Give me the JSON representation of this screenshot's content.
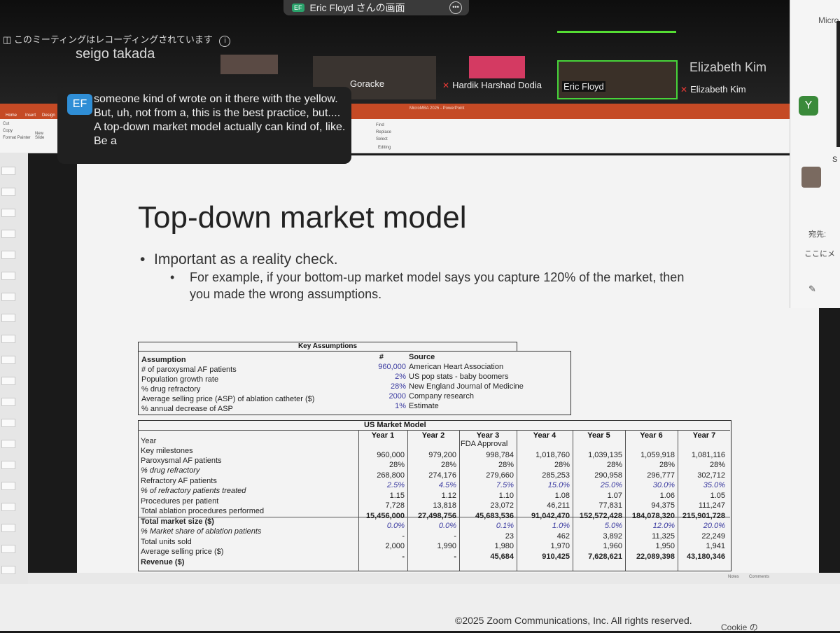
{
  "zoom": {
    "share_title": "Eric Floyd さんの画面",
    "recording_notice": "このミーティングはレコーディングされています",
    "participants": {
      "seigo": "seigo takada",
      "goracke": "Goracke",
      "hardik": "Hardik Harshad Dodia",
      "eric": "Eric Floyd",
      "elizabeth_top": "Elizabeth Kim",
      "elizabeth": "Elizabeth Kim"
    },
    "caption": {
      "badge": "EF",
      "text": "someone kind of wrote on it there with the yellow. But, uh, not from a, this is the best practice, but.... A top-down market model actually can kind of, like. Be a"
    },
    "copyright": "©2025 Zoom Communications, Inc. All rights reserved.",
    "cookie": "Cookie の"
  },
  "ppt": {
    "window_title": "MicroMBA 2025 - PowerPoint",
    "tabs": [
      "Home",
      "Insert",
      "Design"
    ],
    "ribbon": {
      "cut": "Cut",
      "copy": "Copy",
      "painter": "Format Painter",
      "new_slide": "New Slide",
      "find": "Find",
      "replace": "Replace",
      "select": "Select",
      "editing": "Editing"
    }
  },
  "chat_panel": {
    "micro": "Micro",
    "avatar_letter": "Y",
    "to_label": "宛先:",
    "placeholder": "ここにメ",
    "s_label": "S"
  },
  "slide": {
    "title": "Top-down market model",
    "bullet1": "Important as a reality check.",
    "bullet2": "For example, if your bottom-up market model says you capture 120% of the market, then you made the wrong assumptions."
  },
  "key_assumptions": {
    "header": "Key Assumptions",
    "col_assumption": "Assumption",
    "col_num": "#",
    "col_source": "Source",
    "rows": [
      {
        "label": "# of paroxysmal AF patients",
        "value": "960,000",
        "source": "American Heart Association"
      },
      {
        "label": "Population growth rate",
        "value": "2%",
        "source": "US pop stats - baby boomers"
      },
      {
        "label": "% drug refractory",
        "value": "28%",
        "source": "New England Journal of Medicine"
      },
      {
        "label": "Average selling price (ASP) of ablation catheter ($)",
        "value": "2000",
        "source": "Company research"
      },
      {
        "label": "% annual decrease of ASP",
        "value": "1%",
        "source": "Estimate"
      }
    ]
  },
  "market_model": {
    "title": "US Market Model",
    "row_labels": [
      "Year",
      "Key milestones",
      "Paroxysmal AF patients",
      "% drug refractory",
      "Refractory AF patients",
      "% of refractory patients treated",
      "Procedures per patient",
      "Total ablation procedures performed",
      "Total market size ($)",
      "% Market share of ablation patients",
      "Total units sold",
      "Average selling price ($)",
      "Revenue ($)"
    ],
    "years": [
      "Year 1",
      "Year 2",
      "Year 3",
      "Year 4",
      "Year 5",
      "Year 6",
      "Year 7"
    ],
    "milestone": "FDA Approval",
    "columns": [
      [
        "960,000",
        "28%",
        "268,800",
        "2.5%",
        "1.15",
        "7,728",
        "15,456,000",
        "0.0%",
        "-",
        "2,000",
        "-"
      ],
      [
        "979,200",
        "28%",
        "274,176",
        "4.5%",
        "1.12",
        "13,818",
        "27,498,756",
        "0.0%",
        "-",
        "1,990",
        "-"
      ],
      [
        "998,784",
        "28%",
        "279,660",
        "7.5%",
        "1.10",
        "23,072",
        "45,683,536",
        "0.1%",
        "23",
        "1,980",
        "45,684"
      ],
      [
        "1,018,760",
        "28%",
        "285,253",
        "15.0%",
        "1.08",
        "46,211",
        "91,042,470",
        "1.0%",
        "462",
        "1,970",
        "910,425"
      ],
      [
        "1,039,135",
        "28%",
        "290,958",
        "25.0%",
        "1.07",
        "77,831",
        "152,572,428",
        "5.0%",
        "3,892",
        "1,960",
        "7,628,621"
      ],
      [
        "1,059,918",
        "28%",
        "296,777",
        "30.0%",
        "1.06",
        "94,375",
        "184,078,320",
        "12.0%",
        "11,325",
        "1,950",
        "22,089,398"
      ],
      [
        "1,081,116",
        "28%",
        "302,712",
        "35.0%",
        "1.05",
        "111,247",
        "215,901,728",
        "20.0%",
        "22,249",
        "1,941",
        "43,180,346"
      ]
    ]
  },
  "status_bar": {
    "notes": "Notes",
    "comments": "Comments"
  }
}
